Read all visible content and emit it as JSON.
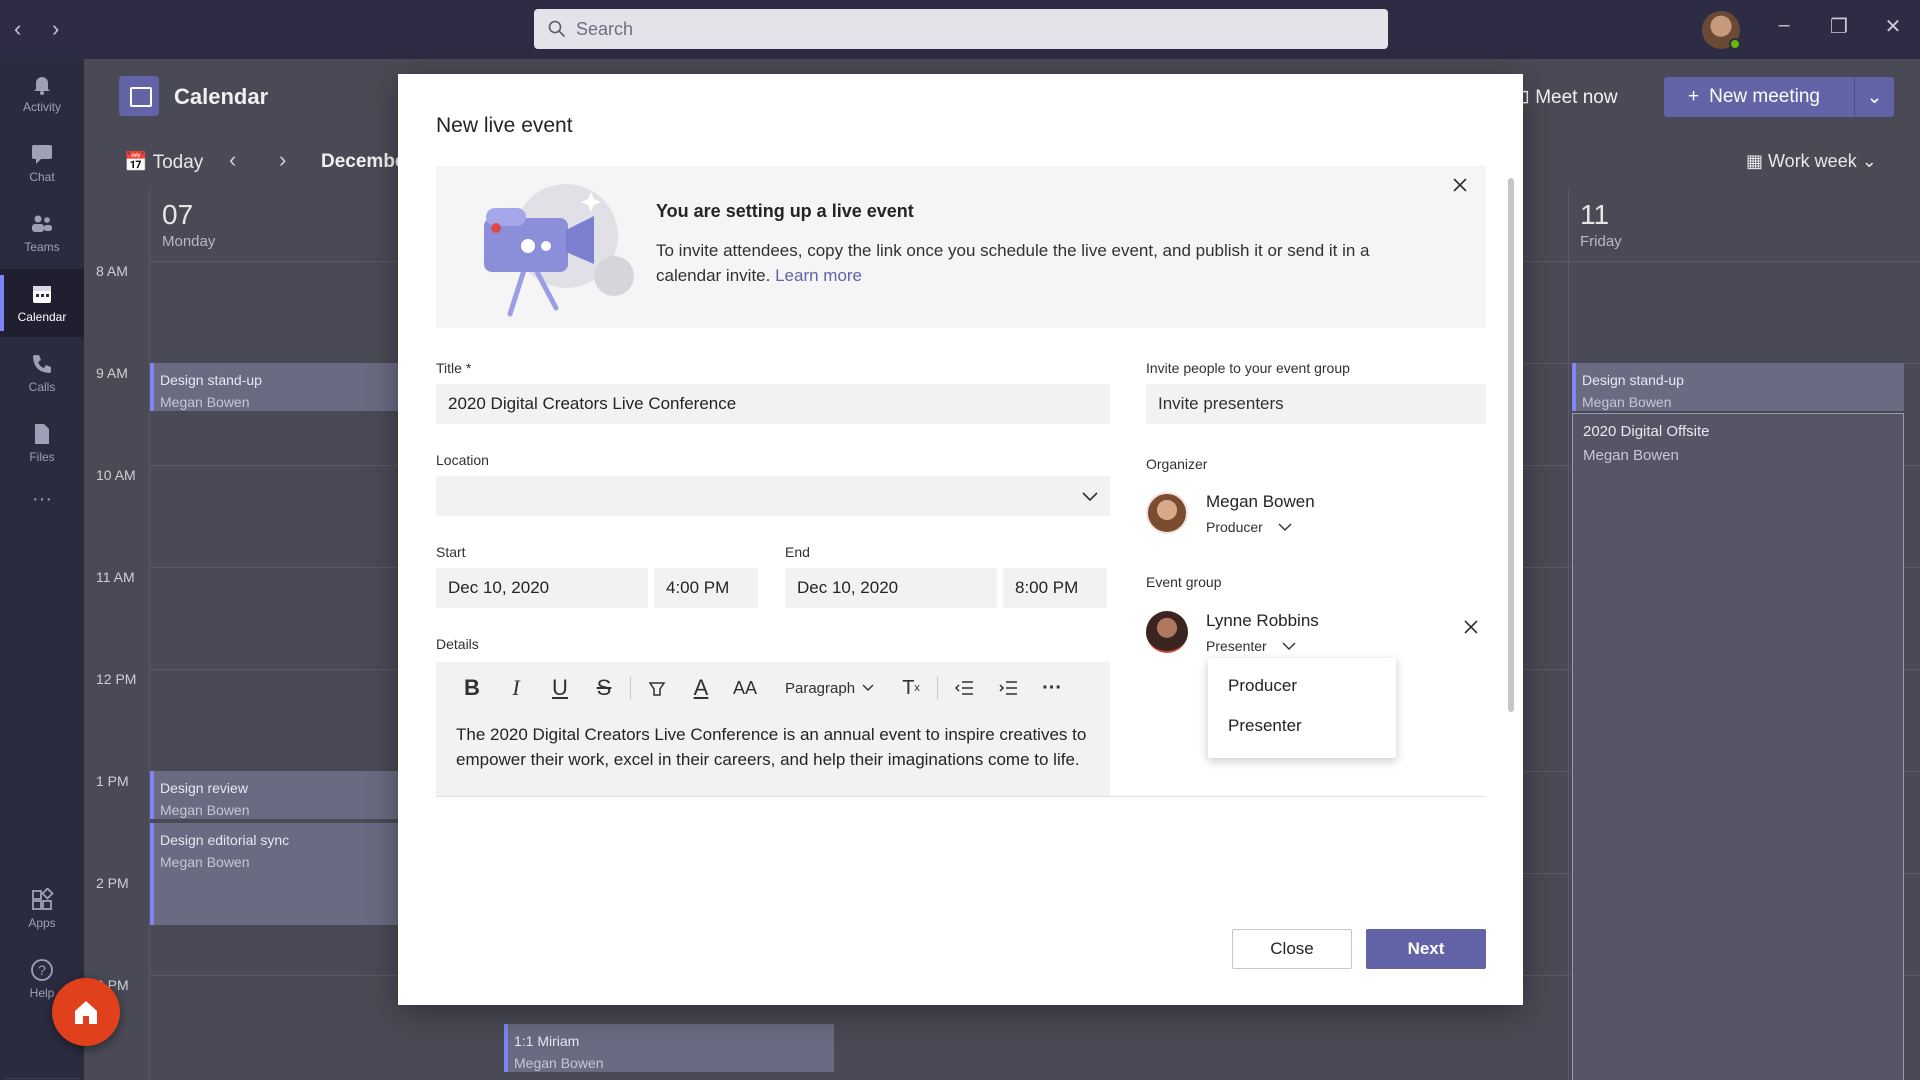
{
  "search": {
    "placeholder": "Search"
  },
  "rail": {
    "items": [
      {
        "label": "Activity",
        "icon": "bell-icon"
      },
      {
        "label": "Chat",
        "icon": "chat-icon"
      },
      {
        "label": "Teams",
        "icon": "teams-icon"
      },
      {
        "label": "Calendar",
        "icon": "calendar-icon"
      },
      {
        "label": "Calls",
        "icon": "phone-icon"
      },
      {
        "label": "Files",
        "icon": "file-icon"
      }
    ],
    "more": "···",
    "apps": "Apps",
    "help": "Help"
  },
  "calendar": {
    "title": "Calendar",
    "meet_now": "Meet now",
    "new_meeting": "New meeting",
    "today": "Today",
    "month": "December",
    "view": "Work week",
    "days": [
      {
        "num": "07",
        "name": "Monday"
      },
      {
        "num": "11",
        "name": "Friday"
      }
    ],
    "times": [
      "8 AM",
      "9 AM",
      "10 AM",
      "11 AM",
      "12 PM",
      "1 PM",
      "2 PM",
      "3 PM"
    ],
    "events": [
      {
        "title": "Design stand-up",
        "sub": "Megan Bowen"
      },
      {
        "title": "Design review",
        "sub": "Megan Bowen"
      },
      {
        "title": "Design editorial sync",
        "sub": "Megan Bowen"
      },
      {
        "title": "Design stand-up",
        "sub": "Megan Bowen"
      },
      {
        "title": "1:1 Miriam",
        "sub": "Megan Bowen"
      }
    ],
    "friday_event": {
      "title": "2020 Digital Offsite",
      "sub": "Megan Bowen"
    }
  },
  "modal": {
    "title": "New live event",
    "banner": {
      "heading": "You are setting up a live event",
      "text": "To invite attendees, copy the link once you schedule the live event, and publish it or send it in a calendar invite.",
      "link": "Learn more"
    },
    "title_label": "Title *",
    "title_value": "2020 Digital Creators Live Conference",
    "location_label": "Location",
    "location_value": "",
    "start_label": "Start",
    "start_date": "Dec 10, 2020",
    "start_time": "4:00 PM",
    "end_label": "End",
    "end_date": "Dec 10, 2020",
    "end_time": "8:00 PM",
    "details_label": "Details",
    "paragraph_label": "Paragraph",
    "details_text": "The 2020 Digital Creators Live Conference is an annual event to inspire creatives to empower their work, excel in their careers, and help their imaginations come to life.",
    "invite_label": "Invite people to your event group",
    "invite_placeholder": "Invite presenters",
    "organizer_label": "Organizer",
    "organizer": {
      "name": "Megan Bowen",
      "role": "Producer"
    },
    "event_group_label": "Event group",
    "member": {
      "name": "Lynne Robbins",
      "role": "Presenter"
    },
    "role_options": [
      "Producer",
      "Presenter"
    ],
    "close_label": "Close",
    "next_label": "Next"
  },
  "colors": {
    "accent": "#6264a7",
    "home_fab": "#e0401c",
    "presence": "#6bb700"
  }
}
